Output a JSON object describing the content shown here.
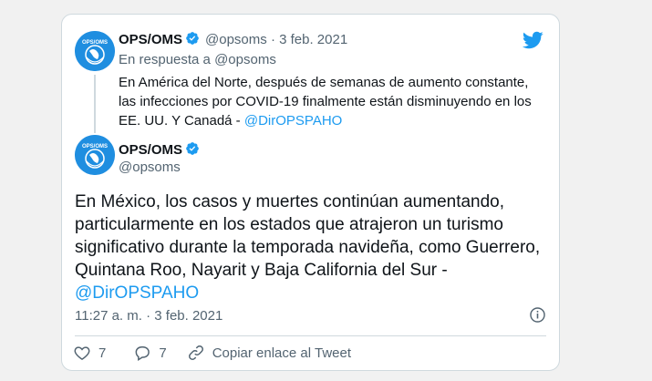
{
  "colors": {
    "accent": "#1d9bf0",
    "muted": "#536471",
    "avatar_bg": "#1f8ee0"
  },
  "parent_tweet": {
    "name": "OPS/OMS",
    "handle": "@opsoms",
    "separator": "·",
    "date": "3 feb. 2021",
    "reply_to_prefix": "En respuesta a",
    "reply_to_handle": "@opsoms",
    "text": "En América del Norte, después de semanas de aumento constante, las infecciones por COVID-19 finalmente están disminuyendo en los EE. UU. Y Canadá - ",
    "mention": "@DirOPSPAHO"
  },
  "avatar_label": "OPS/OMS",
  "main_tweet": {
    "name": "OPS/OMS",
    "handle": "@opsoms",
    "text": "En México, los casos y muertes continúan aumentando, particularmente en los estados que atrajeron un turismo significativo durante la temporada navideña, como Guerrero, Quintana Roo, Nayarit y Baja California del Sur - ",
    "mention": "@DirOPSPAHO",
    "timestamp": "11:27 a. m. · 3 feb. 2021"
  },
  "actions": {
    "likes": "7",
    "replies": "7",
    "copy_link": "Copiar enlace al Tweet"
  },
  "icons": [
    "verified-icon",
    "twitter-bird-icon",
    "info-icon",
    "heart-icon",
    "reply-icon",
    "link-icon"
  ]
}
